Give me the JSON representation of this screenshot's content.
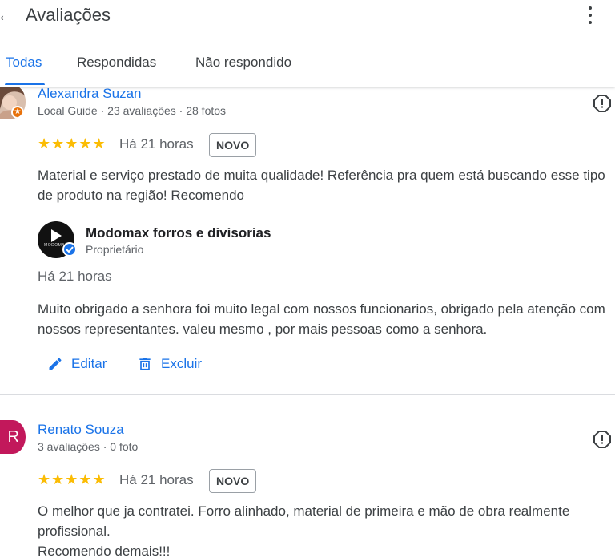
{
  "header": {
    "title": "Avaliações",
    "tabs": [
      {
        "label": "Todas",
        "active": true
      },
      {
        "label": "Respondidas",
        "active": false
      },
      {
        "label": "Não respondido",
        "active": false
      }
    ]
  },
  "reviews": [
    {
      "name": "Alexandra Suzan",
      "meta": "Local Guide · 23 avaliações · 28 fotos",
      "stars": "★★★★★",
      "rating": 5,
      "time": "Há 21 horas",
      "badge": "NOVO",
      "text": "Material e serviço prestado de muita qualidade! Referência pra quem está buscando esse tipo de produto na região! Recomendo",
      "reply": {
        "owner": "Modomax forros e divisorias",
        "role": "Proprietário",
        "logo_text": "MODOMAX",
        "time": "Há 21 horas",
        "text": "Muito obrigado a senhora foi muito legal com nossos funcionarios, obrigado pela atenção com nossos representantes. valeu mesmo , por mais pessoas como a senhora.",
        "edit_label": "Editar",
        "delete_label": "Excluir"
      }
    },
    {
      "name": "Renato Souza",
      "initial": "R",
      "meta": "3 avaliações · 0 foto",
      "stars": "★★★★★",
      "rating": 5,
      "time": "Há 21 horas",
      "badge": "NOVO",
      "text": "O melhor que ja contratei. Forro alinhado, material de primeira e mão de obra realmente profissional.\nRecomendo demais!!!"
    }
  ],
  "colors": {
    "accent": "#1a73e8",
    "star": "#fbbc04",
    "local_guide_badge": "#e8710a",
    "avatar_r": "#c2185b"
  }
}
